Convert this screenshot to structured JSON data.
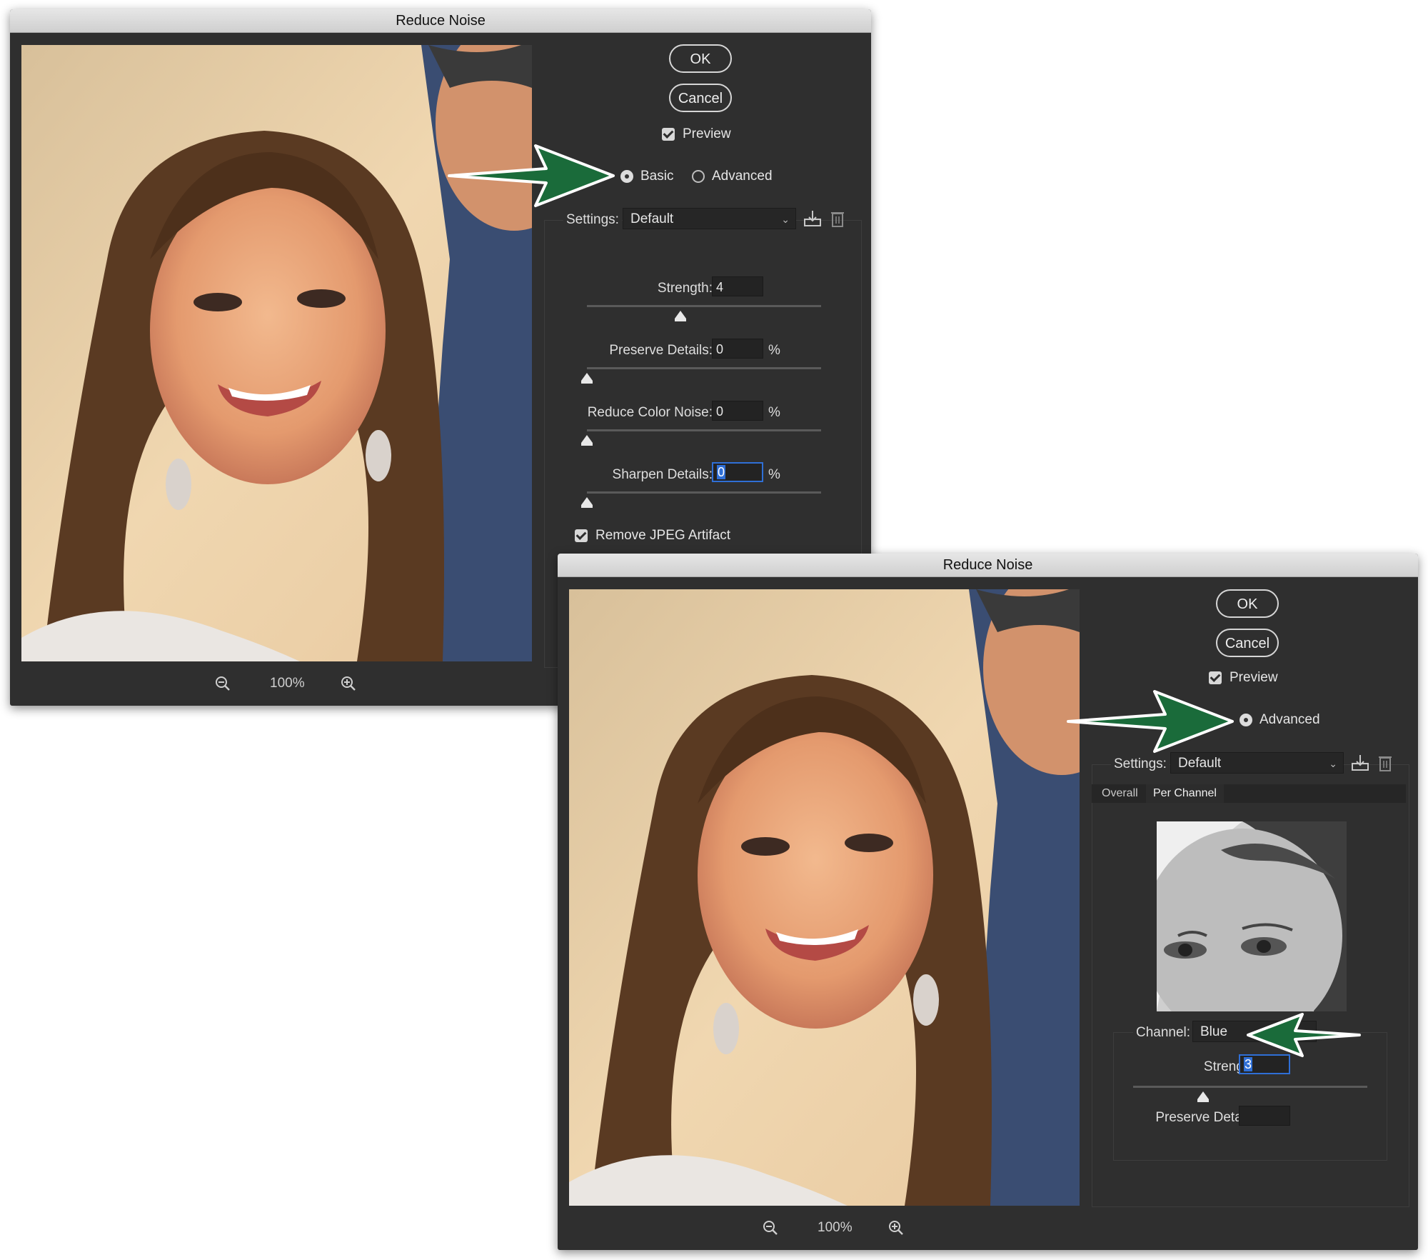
{
  "dialog1": {
    "title": "Reduce Noise",
    "ok_label": "OK",
    "cancel_label": "Cancel",
    "preview_label": "Preview",
    "preview_checked": true,
    "mode_basic_label": "Basic",
    "mode_advanced_label": "Advanced",
    "mode_selected": "Basic",
    "settings_label": "Settings:",
    "settings_value": "Default",
    "sliders": [
      {
        "label": "Strength:",
        "value": "4",
        "unit": "",
        "level": 0.4
      },
      {
        "label": "Preserve Details:",
        "value": "0",
        "unit": "%",
        "level": 0
      },
      {
        "label": "Reduce Color Noise:",
        "value": "0",
        "unit": "%",
        "level": 0
      },
      {
        "label": "Sharpen Details:",
        "value": "0",
        "unit": "%",
        "level": 0
      }
    ],
    "remove_jpeg_label": "Remove JPEG Artifact",
    "remove_jpeg_checked": true,
    "zoom_value": "100%"
  },
  "dialog2": {
    "title": "Reduce Noise",
    "ok_label": "OK",
    "cancel_label": "Cancel",
    "preview_label": "Preview",
    "preview_checked": true,
    "mode_advanced_label": "Advanced",
    "settings_label": "Settings:",
    "settings_value": "Default",
    "tabs": [
      "Overall",
      "Per Channel"
    ],
    "active_tab": "Per Channel",
    "channel_label": "Channel:",
    "channel_value": "Blue",
    "strength_label": "Strength:",
    "strength_value": "3",
    "strength_level": 0.3,
    "preserve_label": "Preserve Details:",
    "zoom_value": "100%"
  },
  "colors": {
    "annotation_arrow": "#1a6b3a",
    "dialog_bg": "#2f2f2f",
    "focus_blue": "#2f6fd6"
  },
  "icons": [
    "zoom-out-icon",
    "zoom-in-icon",
    "save-preset-icon",
    "delete-preset-icon"
  ]
}
